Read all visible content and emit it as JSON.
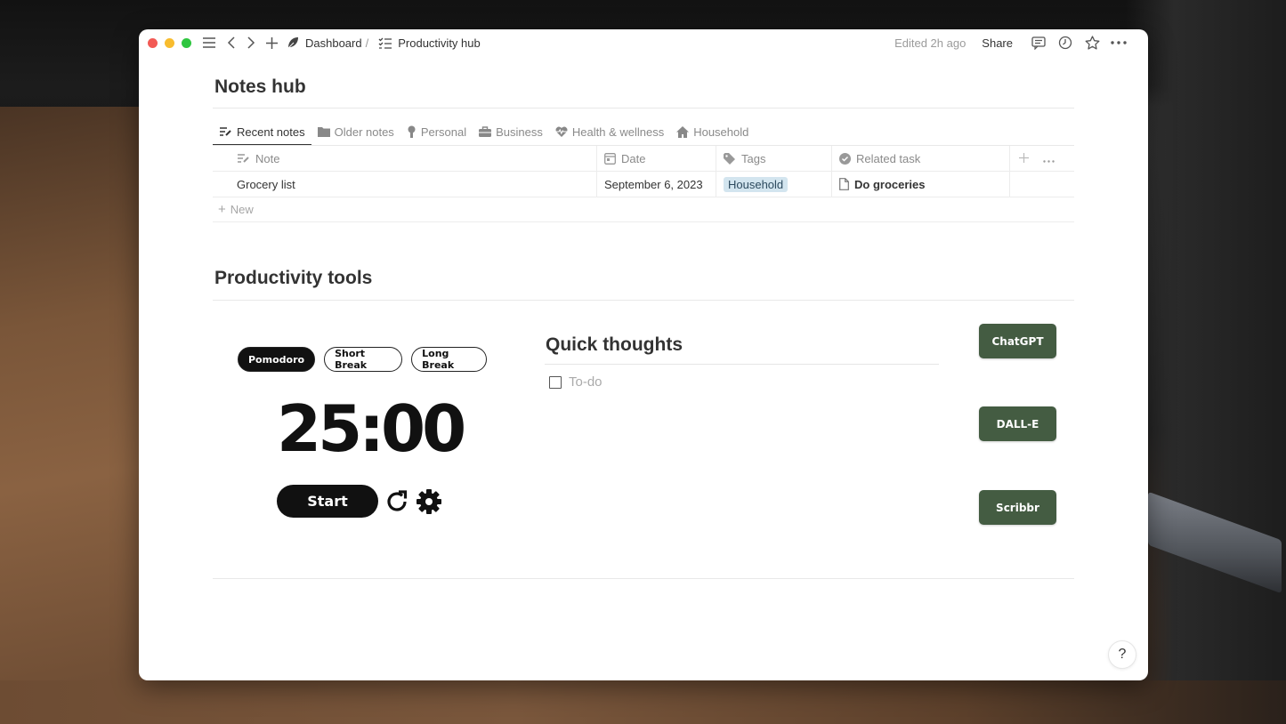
{
  "window": {
    "breadcrumb": [
      {
        "label": "Dashboard",
        "icon": "leaf-icon"
      },
      {
        "label": "Productivity hub",
        "icon": "checklist-icon"
      }
    ],
    "breadcrumb_separator": "/",
    "edited": "Edited 2h ago",
    "share_label": "Share",
    "toolbar_icons": [
      "comment-icon",
      "history-icon",
      "star-icon",
      "more-icon"
    ]
  },
  "notes_hub": {
    "title": "Notes hub",
    "tabs": [
      {
        "label": "Recent notes",
        "icon": "note-edit-icon",
        "active": true
      },
      {
        "label": "Older notes",
        "icon": "folder-icon",
        "active": false
      },
      {
        "label": "Personal",
        "icon": "person-icon",
        "active": false
      },
      {
        "label": "Business",
        "icon": "briefcase-icon",
        "active": false
      },
      {
        "label": "Health & wellness",
        "icon": "heart-pulse-icon",
        "active": false
      },
      {
        "label": "Household",
        "icon": "house-icon",
        "active": false
      }
    ],
    "columns": [
      {
        "label": "Note",
        "icon": "note-edit-icon"
      },
      {
        "label": "Date",
        "icon": "calendar-icon"
      },
      {
        "label": "Tags",
        "icon": "tag-icon"
      },
      {
        "label": "Related task",
        "icon": "check-circle-icon"
      }
    ],
    "rows": [
      {
        "note": "Grocery list",
        "date": "September 6, 2023",
        "tag": "Household",
        "related_task": "Do groceries"
      }
    ],
    "new_label": "New",
    "tag_color": "#d3e5ef"
  },
  "productivity_tools": {
    "title": "Productivity tools",
    "pomodoro": {
      "modes": [
        {
          "label": "Pomodoro",
          "active": true
        },
        {
          "label": "Short Break",
          "active": false
        },
        {
          "label": "Long Break",
          "active": false
        }
      ],
      "time": "25:00",
      "start_label": "Start"
    },
    "quick_thoughts": {
      "title": "Quick thoughts",
      "todo_placeholder": "To-do",
      "checked": false
    },
    "ai_buttons": [
      {
        "label": "ChatGPT"
      },
      {
        "label": "DALL-E"
      },
      {
        "label": "Scribbr"
      }
    ],
    "button_color": "#445c42"
  },
  "help_label": "?"
}
